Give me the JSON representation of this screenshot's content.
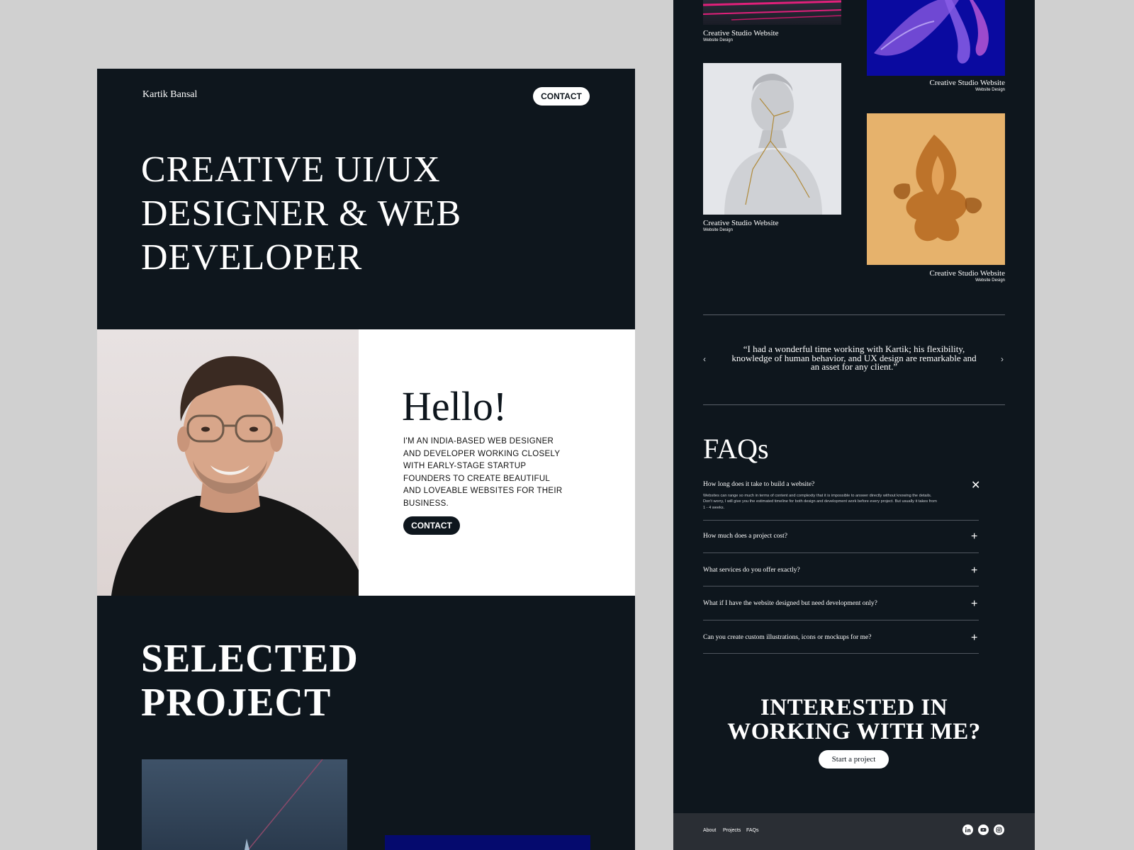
{
  "left": {
    "brand": "Kartik Bansal",
    "nav_contact": "CONTACT",
    "hero_lines": [
      "CREATIVE UI/UX",
      "DESIGNER & WEB",
      "DEVELOPER"
    ],
    "hello": {
      "title": "Hello!",
      "text": "I'M AN INDIA-BASED WEB DESIGNER AND DEVELOPER WORKING CLOSELY WITH EARLY-STAGE STARTUP FOUNDERS TO CREATE BEAUTIFUL AND LOVEABLE WEBSITES FOR THEIR BUSINESS.",
      "contact": "CONTACT"
    },
    "selected_lines": [
      "SELECTED",
      "PROJECT"
    ]
  },
  "right": {
    "cards": [
      {
        "title": "Creative Studio Website",
        "sub": "Website Design"
      },
      {
        "title": "Creative Studio Website",
        "sub": "Website Design"
      },
      {
        "title": "Creative Studio Website",
        "sub": "Website Design"
      },
      {
        "title": "Creative Studio Website",
        "sub": "Website Design"
      }
    ],
    "quote": "“I had a wonderful time working with Kartik; his flexibility, knowledge of human behavior, and UX design are remarkable and an asset for any client.”",
    "faq_title": "FAQs",
    "faqs": [
      {
        "q": "How long does it take to build a website?",
        "a": "Websites can range so much in terms of content and complexity that it is impossible to answer directly without knowing the details. Don't worry, I will give you the estimated timeline for both design and development work before every project. But usually it takes from 1 - 4 weeks."
      },
      {
        "q": "How much does a project cost?"
      },
      {
        "q": "What services do you offer exactly?"
      },
      {
        "q": "What if I have the website designed but need development only?"
      },
      {
        "q": "Can you create custom illustrations, icons or mockups for me?"
      }
    ],
    "cta_lines": [
      "INTERESTED IN",
      "WORKING WITH ME?"
    ],
    "cta_button": "Start a project",
    "footer_links": [
      "About",
      "Projects",
      "FAQs"
    ],
    "social_icons": [
      "linkedin-icon",
      "youtube-icon",
      "instagram-icon"
    ]
  }
}
